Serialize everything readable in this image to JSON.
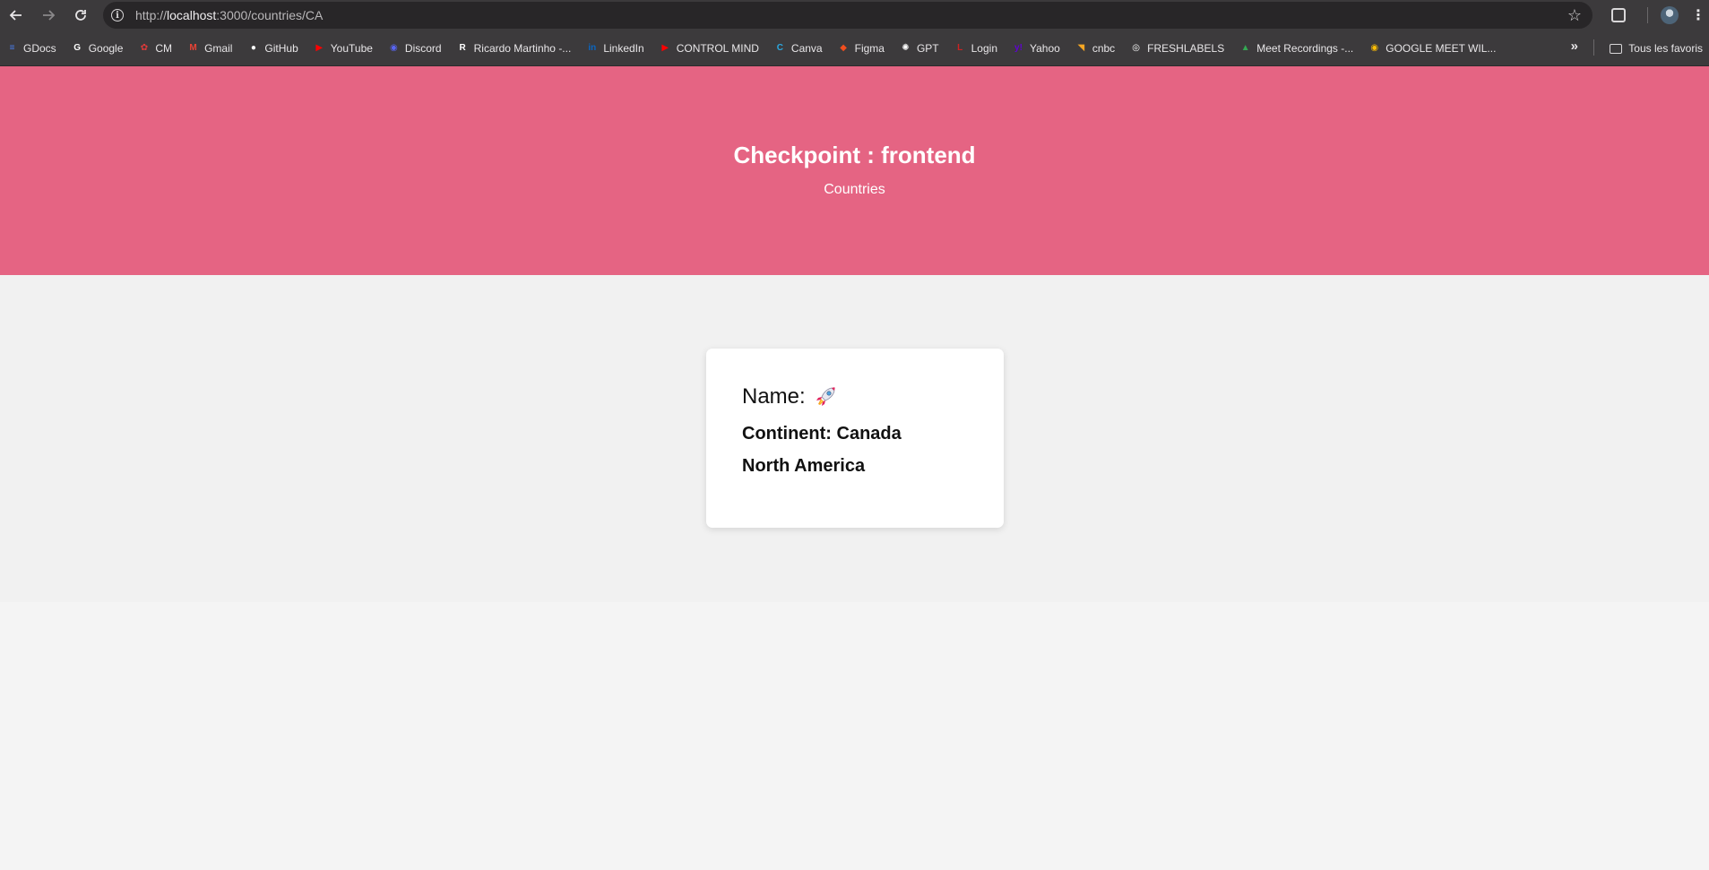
{
  "browser": {
    "url_prefix": "http://",
    "url_host": "localhost",
    "url_path": ":3000/countries/CA",
    "bookmarks": [
      {
        "label": "GDocs",
        "icon": "gdocs-icon",
        "color": "#4a7ff0"
      },
      {
        "label": "Google",
        "icon": "google-icon",
        "color": "#ffffff"
      },
      {
        "label": "CM",
        "icon": "cm-icon",
        "color": "#e03a3a"
      },
      {
        "label": "Gmail",
        "icon": "gmail-icon",
        "color": "#ea4335"
      },
      {
        "label": "GitHub",
        "icon": "github-icon",
        "color": "#ffffff"
      },
      {
        "label": "YouTube",
        "icon": "youtube-icon",
        "color": "#ff0000"
      },
      {
        "label": "Discord",
        "icon": "discord-icon",
        "color": "#5865f2"
      },
      {
        "label": "Ricardo Martinho -...",
        "icon": "ricardo-icon",
        "color": "#ffffff"
      },
      {
        "label": "LinkedIn",
        "icon": "linkedin-icon",
        "color": "#0a66c2"
      },
      {
        "label": "CONTROL MIND",
        "icon": "youtube-icon",
        "color": "#ff0000"
      },
      {
        "label": "Canva",
        "icon": "canva-icon",
        "color": "#2aa8e0"
      },
      {
        "label": "Figma",
        "icon": "figma-icon",
        "color": "#f24e1e"
      },
      {
        "label": "GPT",
        "icon": "openai-icon",
        "color": "#ffffff"
      },
      {
        "label": "Login",
        "icon": "login-icon",
        "color": "#cc2222"
      },
      {
        "label": "Yahoo",
        "icon": "yahoo-icon",
        "color": "#6001d2"
      },
      {
        "label": "cnbc",
        "icon": "cnbc-icon",
        "color": "#f5a623"
      },
      {
        "label": "FRESHLABELS",
        "icon": "globe-icon",
        "color": "#ffffff"
      },
      {
        "label": "Meet Recordings -...",
        "icon": "drive-icon",
        "color": "#34a853"
      },
      {
        "label": "GOOGLE MEET WIL...",
        "icon": "chrome-icon",
        "color": "#fbbc05"
      }
    ],
    "overflow_label": "»",
    "all_bookmarks_label": "Tous les favoris"
  },
  "header": {
    "title": "Checkpoint : frontend",
    "subtitle": "Countries"
  },
  "country": {
    "name_label": "Name:",
    "flag_icon": "rocket-emoji-icon",
    "continent_label": "Continent: Canada",
    "continent_value": "North America"
  },
  "colors": {
    "header_bg": "#e56483",
    "content_bg": "#f1f1f1",
    "page_bg": "#f4f4f4",
    "card_bg": "#ffffff"
  }
}
